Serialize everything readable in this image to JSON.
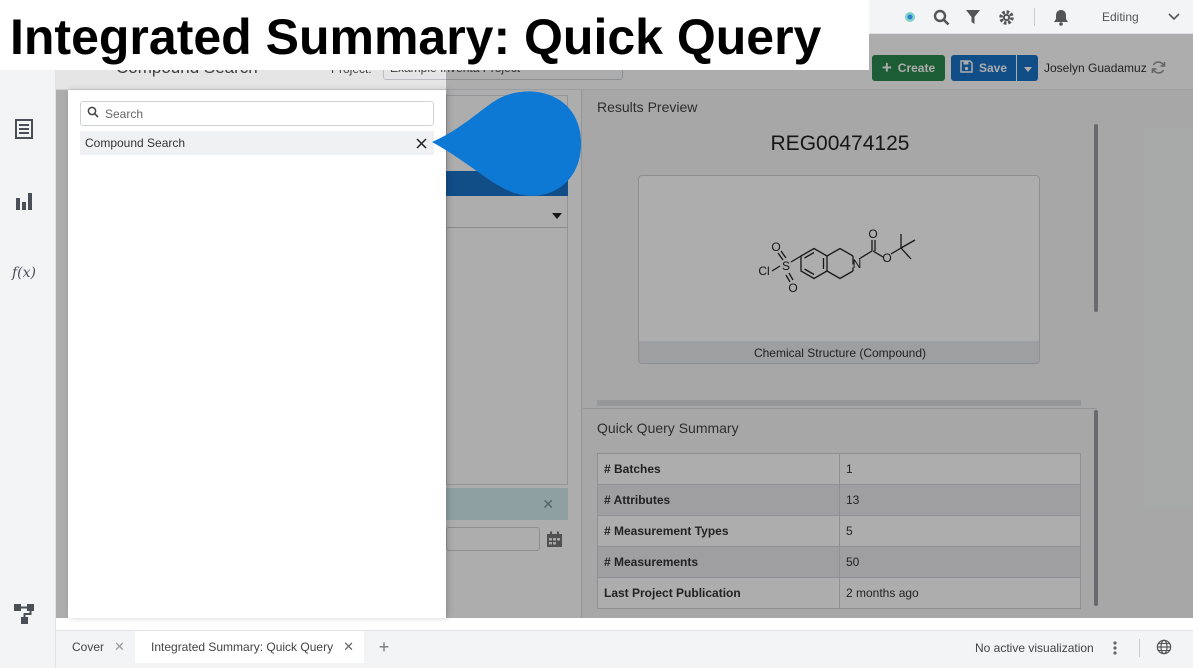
{
  "overlay_title": "Integrated Summary: Quick Query",
  "topbar": {
    "mode": "Editing",
    "icons": [
      "cluster-icon",
      "search-icon",
      "filter-icon",
      "gear-icon",
      "bell-icon",
      "chevron-down-icon"
    ]
  },
  "left_rail": {
    "icons": [
      "table-icon",
      "bar-chart-icon",
      "function-icon",
      "hierarchy-icon"
    ],
    "function_glyph": "f(x)"
  },
  "header": {
    "page_title": "Compound Search",
    "project_label": "Project:",
    "project_value": "Example Inventa Project",
    "create_label": "Create",
    "save_label": "Save",
    "user_name": "Joselyn Guadamuz"
  },
  "dropdown": {
    "search_placeholder": "Search",
    "items": [
      {
        "label": "Compound Search"
      }
    ]
  },
  "results_preview": {
    "title": "Results Preview",
    "reg_number": "REG00474125",
    "structure_caption": "Chemical Structure (Compound)",
    "atom_labels": {
      "cl": "Cl",
      "s": "S",
      "o1": "O",
      "o2": "O",
      "n": "N",
      "o3": "O",
      "o4": "O"
    }
  },
  "summary": {
    "title": "Quick Query Summary",
    "rows": [
      {
        "key": "# Batches",
        "value": "1"
      },
      {
        "key": "# Attributes",
        "value": "13"
      },
      {
        "key": "# Measurement Types",
        "value": "5"
      },
      {
        "key": "# Measurements",
        "value": "50"
      },
      {
        "key": "Last Project Publication",
        "value": "2 months ago"
      }
    ]
  },
  "bottom": {
    "tabs": [
      {
        "label": "Cover"
      },
      {
        "label": "Integrated Summary: Quick Query"
      }
    ],
    "status": "No active visualization"
  },
  "colors": {
    "create": "#2a8a4e",
    "save": "#1a73c9",
    "pointer": "#0e78d5"
  }
}
